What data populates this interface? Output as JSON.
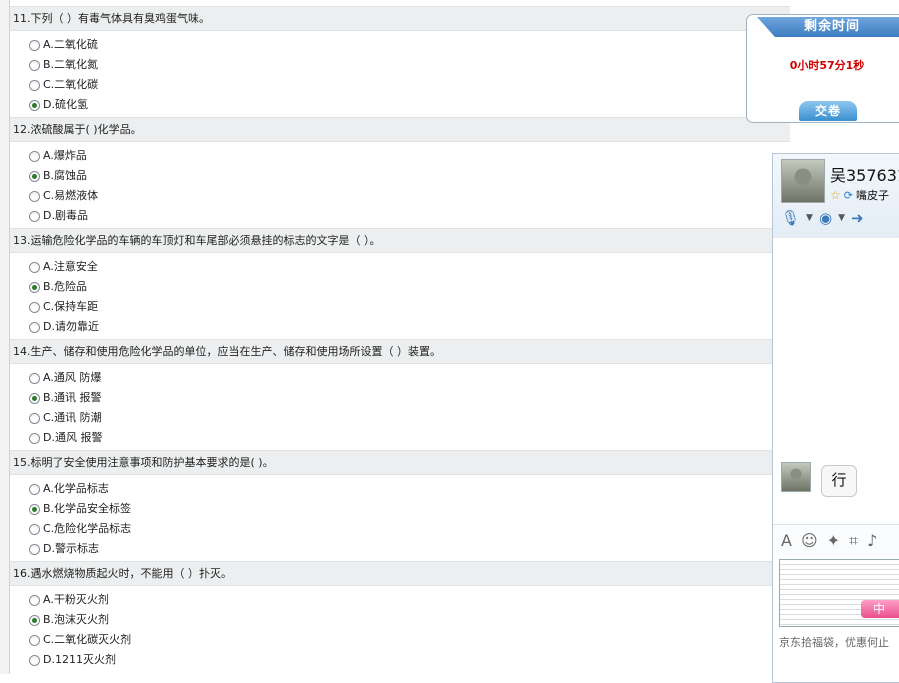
{
  "questions": [
    {
      "title": "11.下列（  ）有毒气体具有臭鸡蛋气味。",
      "options": [
        "A.二氧化硫",
        "B.二氧化氮",
        "C.二氧化碳",
        "D.硫化氢"
      ],
      "selected": 3
    },
    {
      "title": "12.浓硫酸属于( )化学品。",
      "options": [
        "A.爆炸品",
        "B.腐蚀品",
        "C.易燃液体",
        "D.剧毒品"
      ],
      "selected": 1
    },
    {
      "title": "13.运输危险化学品的车辆的车顶灯和车尾部必须悬挂的标志的文字是（  ）。",
      "options": [
        "A.注意安全",
        "B.危险品",
        "C.保持车距",
        "D.请勿靠近"
      ],
      "selected": 1
    },
    {
      "title": "14.生产、储存和使用危险化学品的单位，应当在生产、储存和使用场所设置（  ）装置。",
      "options": [
        "A.通风 防爆",
        "B.通讯 报警",
        "C.通讯 防潮",
        "D.通风 报警"
      ],
      "selected": 1
    },
    {
      "title": "15.标明了安全使用注意事项和防护基本要求的是( )。",
      "options": [
        "A.化学品标志",
        "B.化学品安全标签",
        "C.危险化学品标志",
        "D.警示标志"
      ],
      "selected": 1
    },
    {
      "title": "16.遇水燃烧物质起火时，不能用（  ）扑灭。",
      "options": [
        "A.干粉灭火剂",
        "B.泡沫灭火剂",
        "C.二氧化碳灭火剂",
        "D.1211灭火剂"
      ],
      "selected": 1
    }
  ],
  "timer": {
    "title": "剩余时间",
    "value": "0小时57分1秒",
    "submit_label": "交卷"
  },
  "chat": {
    "contact_name": "吴357631",
    "contact_status": "嘴皮子",
    "message": "行",
    "ime_label": "中",
    "ad_text": "京东拾福袋，优惠何止"
  }
}
